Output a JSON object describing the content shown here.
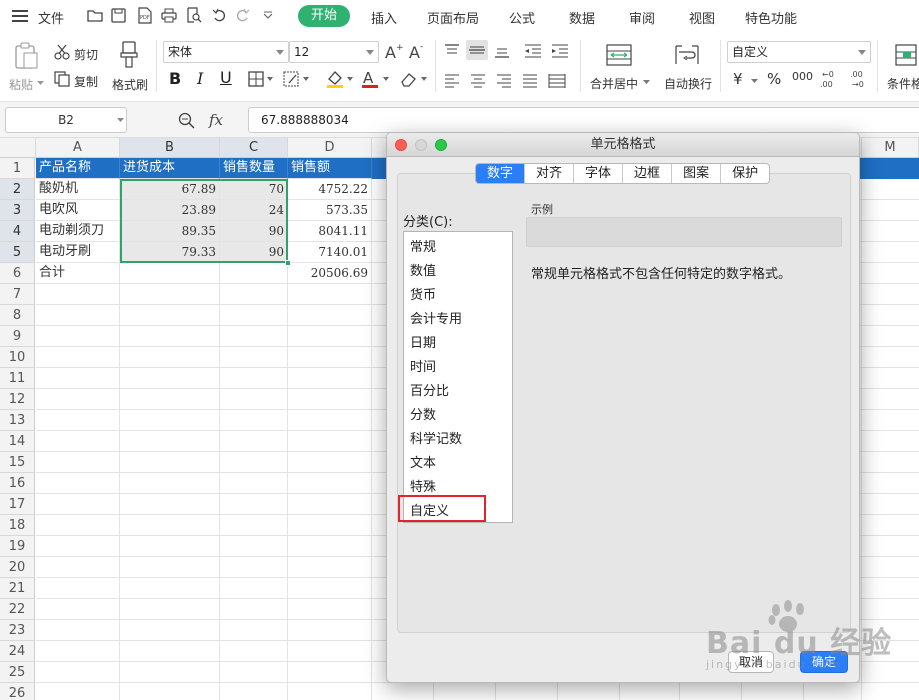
{
  "menu": {
    "file": "文件",
    "tabs": [
      "开始",
      "插入",
      "页面布局",
      "公式",
      "数据",
      "审阅",
      "视图",
      "特色功能"
    ]
  },
  "ribbon": {
    "paste": "粘贴",
    "cut": "剪切",
    "copy": "复制",
    "format_painter": "格式刷",
    "font_name": "宋体",
    "font_size": "12",
    "bold": "B",
    "italic": "I",
    "underline": "U",
    "merge_center": "合并居中",
    "wrap_text": "自动换行",
    "number_format": "自定义",
    "currency": "¥",
    "percent": "%",
    "thousands": "000",
    "conditional": "条件格"
  },
  "formula_bar": {
    "cell_ref": "B2",
    "fx": "fx",
    "value": "67.888888034"
  },
  "sheet": {
    "columns": [
      "A",
      "B",
      "C",
      "D",
      "M"
    ],
    "rows": [
      "1",
      "2",
      "3",
      "4",
      "5",
      "6",
      "7",
      "8",
      "9",
      "10",
      "11",
      "12",
      "13",
      "14",
      "15",
      "16",
      "17",
      "18",
      "19",
      "20",
      "21",
      "22",
      "23",
      "24",
      "25",
      "26"
    ],
    "header": [
      "产品名称",
      "进货成本",
      "销售数量",
      "销售额"
    ],
    "data": [
      [
        "酸奶机",
        "67.89",
        "70",
        "4752.22"
      ],
      [
        "电吹风",
        "23.89",
        "24",
        "573.35"
      ],
      [
        "电动剃须刀",
        "89.35",
        "90",
        "8041.11"
      ],
      [
        "电动牙刷",
        "79.33",
        "90",
        "7140.01"
      ],
      [
        "合计",
        "",
        "",
        "20506.69"
      ]
    ]
  },
  "dialog": {
    "title": "单元格格式",
    "tabs": [
      "数字",
      "对齐",
      "字体",
      "边框",
      "图案",
      "保护"
    ],
    "category_label": "分类(C):",
    "categories": [
      "常规",
      "数值",
      "货币",
      "会计专用",
      "日期",
      "时间",
      "百分比",
      "分数",
      "科学记数",
      "文本",
      "特殊",
      "自定义"
    ],
    "sample_label": "示例",
    "description": "常规单元格格式不包含任何特定的数字格式。",
    "cancel": "取消",
    "ok": "确定"
  },
  "watermark": {
    "text": "Bai du 经验",
    "url": "jingyan.baidu.com"
  },
  "colors": {
    "accent_green": "#2fb26f",
    "header_blue": "#1f6fc4",
    "dialog_tab_blue": "#2a7ff6",
    "highlight_red": "#e0262c"
  }
}
